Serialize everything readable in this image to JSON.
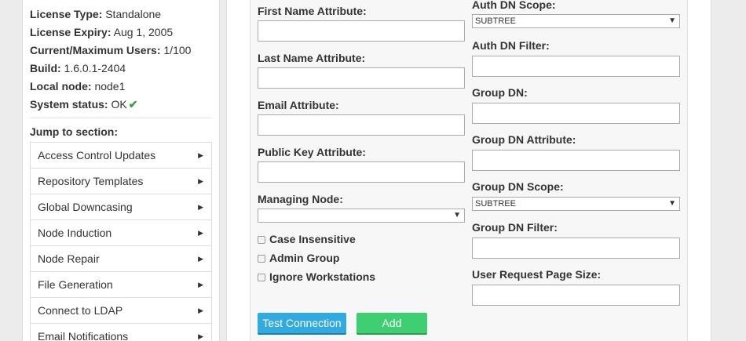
{
  "info": [
    {
      "label": "License Type:",
      "value": "Standalone"
    },
    {
      "label": "License Expiry:",
      "value": "Aug 1, 2005"
    },
    {
      "label": "Current/Maximum Users:",
      "value": "1/100"
    },
    {
      "label": "Build:",
      "value": "1.6.0.1-2404"
    },
    {
      "label": "Local node:",
      "value": "node1"
    },
    {
      "label": "System status:",
      "value": "OK"
    }
  ],
  "jump_label": "Jump to section:",
  "menu": [
    "Access Control Updates",
    "Repository Templates",
    "Global Downcasing",
    "Node Induction",
    "Node Repair",
    "File Generation",
    "Connect to LDAP",
    "Email Notifications"
  ],
  "form": {
    "first_name_label": "First Name Attribute:",
    "last_name_label": "Last Name Attribute:",
    "email_label": "Email Attribute:",
    "public_key_label": "Public Key Attribute:",
    "managing_node_label": "Managing Node:",
    "managing_node_value": "",
    "auth_dn_scope_label": "Auth DN Scope:",
    "auth_dn_scope_value": "SUBTREE",
    "auth_dn_filter_label": "Auth DN Filter:",
    "group_dn_label": "Group DN:",
    "group_dn_attr_label": "Group DN Attribute:",
    "group_dn_scope_label": "Group DN Scope:",
    "group_dn_scope_value": "SUBTREE",
    "group_dn_filter_label": "Group DN Filter:",
    "user_request_page_size_label": "User Request Page Size:",
    "case_insensitive_label": "Case Insensitive",
    "admin_group_label": "Admin Group",
    "ignore_workstations_label": "Ignore Workstations",
    "test_connection_label": "Test Connection",
    "add_label": "Add"
  }
}
